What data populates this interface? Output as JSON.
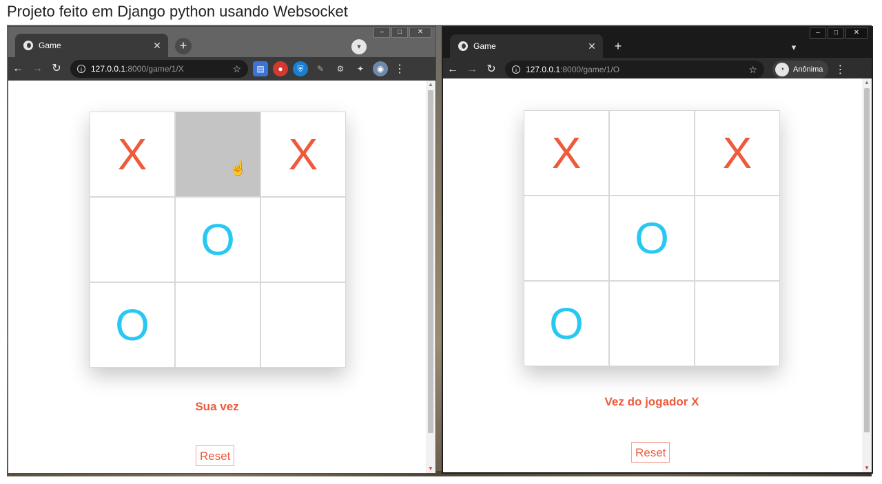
{
  "caption": "Projeto feito em Django python usando Websocket",
  "colors": {
    "x_mark": "#ef5a3a",
    "o_mark": "#29c8f2",
    "status": "#ec5b3d",
    "hover_cell": "#c4c4c4"
  },
  "windows": {
    "left": {
      "tab_title": "Game",
      "url_host": "127.0.0.1",
      "url_path": ":8000/game/1/X",
      "hovered_cell": 1,
      "board": [
        "X",
        "",
        "X",
        "",
        "O",
        "",
        "O",
        "",
        ""
      ],
      "status": "Sua vez",
      "reset_label": "Reset",
      "extensions": [
        "docs-icon",
        "adblock-icon",
        "vpn-icon",
        "pen-icon",
        "gear-icon",
        "puzzle-icon",
        "profile-avatar"
      ]
    },
    "right": {
      "tab_title": "Game",
      "url_host": "127.0.0.1",
      "url_path": ":8000/game/1/O",
      "incognito_label": "Anônima",
      "board": [
        "X",
        "",
        "X",
        "",
        "O",
        "",
        "O",
        "",
        ""
      ],
      "status": "Vez do jogador X",
      "reset_label": "Reset"
    }
  }
}
